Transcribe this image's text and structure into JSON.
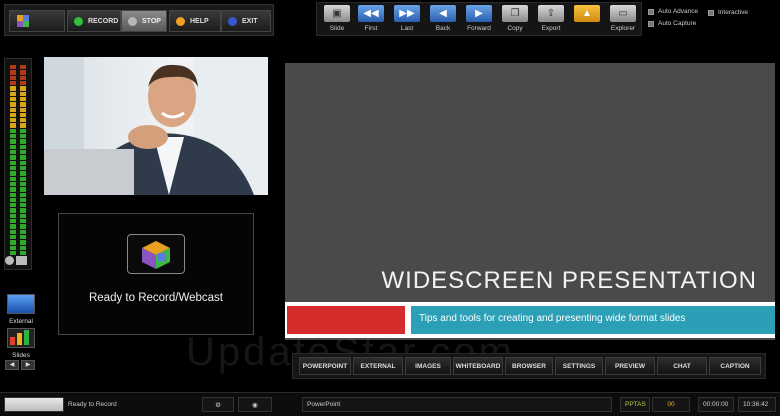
{
  "toolbar": {
    "record_label": "RECORD",
    "stop_label": "STOP",
    "help_label": "HELP",
    "exit_label": "EXIT",
    "colors": {
      "record": "#2fbf3a",
      "stop": "#9a9a9a",
      "help": "#f0a020",
      "exit": "#3a55d0"
    }
  },
  "tools": {
    "slide": "Slide",
    "first": "First",
    "last": "Last",
    "back": "Back",
    "forward": "Forward",
    "copy": "Copy",
    "export": "Export",
    "explorer": "Explorer"
  },
  "options": {
    "auto_advance": "Auto Advance",
    "interactive": "Interactive",
    "auto_capture": "Auto Capture"
  },
  "side": {
    "external_label": "External",
    "slides_label": "Slides"
  },
  "ready_text": "Ready to Record/Webcast",
  "slide": {
    "title": "WIDESCREEN PRESENTATION",
    "subtitle": "Tips and tools for creating and presenting wide format slides"
  },
  "tabs": [
    "POWERPOINT",
    "EXTERNAL",
    "IMAGES",
    "WHITEBOARD",
    "BROWSER",
    "SETTINGS",
    "PREVIEW",
    "CHAT",
    "CAPTION"
  ],
  "watermark": "UpdateStar.com",
  "status": {
    "message": "Ready to Record",
    "app": "PowerPoint",
    "mode": "PPTAS",
    "counter": "00",
    "elapsed": "00:00:00",
    "clock": "10:36:42"
  }
}
